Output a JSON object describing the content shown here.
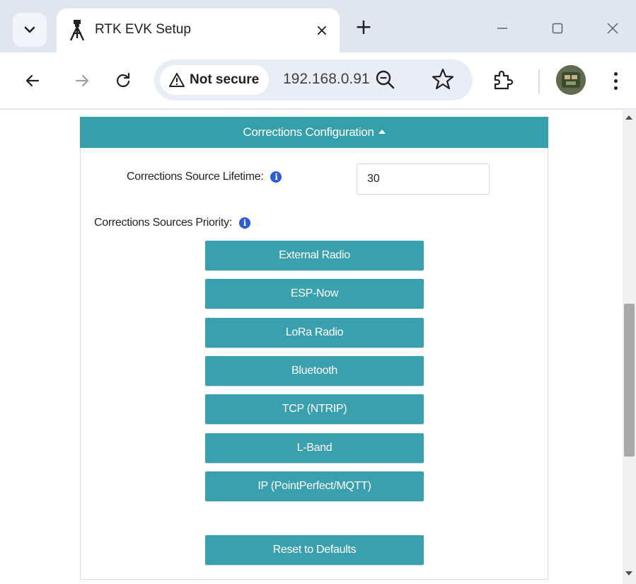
{
  "browser": {
    "tab_title": "RTK EVK Setup",
    "close_glyph": "×",
    "new_tab_glyph": "+",
    "security_label": "Not secure",
    "url": "192.168.0.91"
  },
  "panel": {
    "header": "Corrections Configuration",
    "lifetime_label": "Corrections Source Lifetime:",
    "lifetime_value": "30",
    "priority_label": "Corrections Sources Priority:",
    "sources": [
      "External Radio",
      "ESP-Now",
      "LoRa Radio",
      "Bluetooth",
      "TCP (NTRIP)",
      "L-Band",
      "IP (PointPerfect/MQTT)"
    ],
    "reset_label": "Reset to Defaults"
  },
  "colors": {
    "accent": "#35a0aa",
    "info": "#2c5bd8"
  }
}
